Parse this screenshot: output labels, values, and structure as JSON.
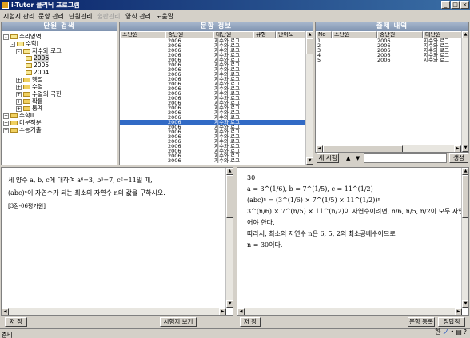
{
  "window": {
    "title": "i-Tutor 클리닉 프로그램",
    "buttons": {
      "minimize": "_",
      "maximize": "□",
      "close": "×"
    }
  },
  "menu": [
    {
      "label": "시험지 관리",
      "enabled": true
    },
    {
      "label": "문항 관리",
      "enabled": true
    },
    {
      "label": "단원관리",
      "enabled": true
    },
    {
      "label": "출판관리",
      "enabled": false
    },
    {
      "label": "양식 관리",
      "enabled": true
    },
    {
      "label": "도움말",
      "enabled": true
    }
  ],
  "unit_search": {
    "title": "단원 검색",
    "tree": [
      {
        "label": "수리영역",
        "toggle": "-",
        "icon": "book-icon"
      },
      {
        "label": "수학I",
        "toggle": "-",
        "icon": "folder-open-icon"
      },
      {
        "label": "지수와 로그",
        "toggle": "-",
        "icon": "folder-open-icon"
      },
      {
        "label": "2006",
        "toggle": "",
        "icon": "leaf-folder-icon",
        "selected": true
      },
      {
        "label": "2005",
        "toggle": "",
        "icon": "leaf-folder-icon"
      },
      {
        "label": "2004",
        "toggle": "",
        "icon": "leaf-folder-icon"
      },
      {
        "label": "행렬",
        "toggle": "+",
        "icon": "folder-icon"
      },
      {
        "label": "수열",
        "toggle": "+",
        "icon": "folder-icon"
      },
      {
        "label": "수열의 극한",
        "toggle": "+",
        "icon": "folder-icon"
      },
      {
        "label": "확률",
        "toggle": "+",
        "icon": "folder-icon"
      },
      {
        "label": "통계",
        "toggle": "+",
        "icon": "folder-icon"
      },
      {
        "label": "수학II",
        "toggle": "+",
        "icon": "folder-icon"
      },
      {
        "label": "미분적분",
        "toggle": "+",
        "icon": "folder-icon"
      },
      {
        "label": "수능기출",
        "toggle": "+",
        "icon": "folder-icon"
      }
    ]
  },
  "question_info": {
    "title": "문항 정보",
    "columns": [
      "소단원",
      "중단원",
      "대단원",
      "유형",
      "난이도"
    ],
    "rows_mid": [
      "2006",
      "2006",
      "2006",
      "2006",
      "2006",
      "2006",
      "2006",
      "2006",
      "2006",
      "2006",
      "2006",
      "2006",
      "2006",
      "2006",
      "2006",
      "2006",
      "2006",
      "2006",
      "2006",
      "2006",
      "2006",
      "2006",
      "2006",
      "2006",
      "2006",
      "2006"
    ],
    "rows_big": [
      "지수와 로그",
      "지수와 로그",
      "지수와 로그",
      "지수와 로그",
      "지수와 로그",
      "지수와 로그",
      "지수와 로그",
      "지수와 로그",
      "지수와 로그",
      "지수와 로그",
      "지수와 로그",
      "지수와 로그",
      "지수와 로그",
      "지수와 로그",
      "지수와 로그",
      "지수와 로그",
      "지수와 로그",
      "지수와 로그",
      "지수와 로그",
      "지수와 로그",
      "지수와 로그",
      "지수와 로그",
      "지수와 로그",
      "지수와 로그",
      "지수와 로그",
      "지수와 로그"
    ],
    "selected_row": 17
  },
  "exam_list": {
    "title": "출제 내역",
    "columns": [
      "No",
      "소단원",
      "중단원",
      "대단원"
    ],
    "rows": [
      {
        "no": "1",
        "mid": "2006",
        "big": "지수와 로그"
      },
      {
        "no": "2",
        "mid": "2006",
        "big": "지수와 로그"
      },
      {
        "no": "3",
        "mid": "2006",
        "big": "지수와 로그"
      },
      {
        "no": "4",
        "mid": "2006",
        "big": "지수와 로그"
      },
      {
        "no": "5",
        "mid": "2006",
        "big": "지수와 로그"
      }
    ],
    "new_exam_button": "새 시험",
    "up_arrow": "▲",
    "down_arrow": "▼",
    "generate_button": "생성"
  },
  "question_text": {
    "lines": [
      "세 양수  a,  b,  c에 대하여  a⁶=3,  b⁵=7,  c²=11일 때,",
      "(abc)ⁿ이 자연수가 되는 최소의 자연수  n의 값을 구하시오.",
      "[3점-06평가원]"
    ],
    "save_button": "저 장",
    "view_exam_button": "시험지 보기"
  },
  "answer_text": {
    "lines": [
      "30",
      "a = 3^(1/6),  b = 7^(1/5),  c = 11^(1/2)",
      "(abc)ⁿ = (3^(1/6) × 7^(1/5) × 11^(1/2))ⁿ",
      "3^(n/6) × 7^(n/5) × 11^(n/2)이 자연수이려면,  n/6,  n/5,  n/2이 모두 자연수이",
      "어야 한다.",
      "따라서,  최소의  자연수  n은  6,  5,  2의  최소공배수이므로",
      "n = 30이다."
    ],
    "save_button": "저 장",
    "register_button": "문항 등록",
    "type_button": "정답첨"
  },
  "status": {
    "text": "준비",
    "ime": [
      "한",
      "ノ",
      "•",
      "▤",
      "?"
    ]
  }
}
